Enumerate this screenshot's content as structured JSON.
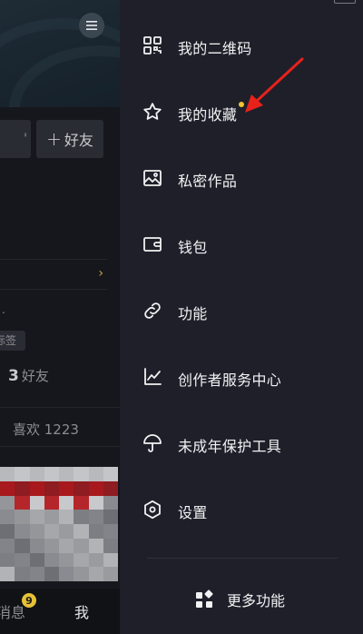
{
  "background": {
    "add_friend_label": "好友",
    "add_friend_plus": "+",
    "edit_fragment": "'",
    "row_chevron": "›",
    "dot_text": ".",
    "tag_fragment": "标签",
    "friends_count": "3",
    "friends_label": "好友",
    "likes": "喜欢 1223",
    "bottom_nav": {
      "messages_label": "消息",
      "messages_badge": "9",
      "me_label": "我"
    }
  },
  "drawer": {
    "items": [
      {
        "label": "我的二维码",
        "icon": "qr-code-icon"
      },
      {
        "label": "我的收藏",
        "icon": "star-icon",
        "has_new_dot": true
      },
      {
        "label": "私密作品",
        "icon": "image-icon"
      },
      {
        "label": "钱包",
        "icon": "wallet-icon"
      },
      {
        "label": "功能",
        "icon": "link-icon"
      },
      {
        "label": "创作者服务中心",
        "icon": "chart-line-icon"
      },
      {
        "label": "未成年保护工具",
        "icon": "umbrella-icon"
      },
      {
        "label": "设置",
        "icon": "settings-hexagon-icon"
      }
    ],
    "more_label": "更多功能",
    "more_icon": "grid-apps-icon"
  },
  "colors": {
    "drawer_bg": "#1e1f29",
    "new_dot": "#f4c430",
    "badge": "#e7c136",
    "annotation_arrow": "#e8211b"
  }
}
